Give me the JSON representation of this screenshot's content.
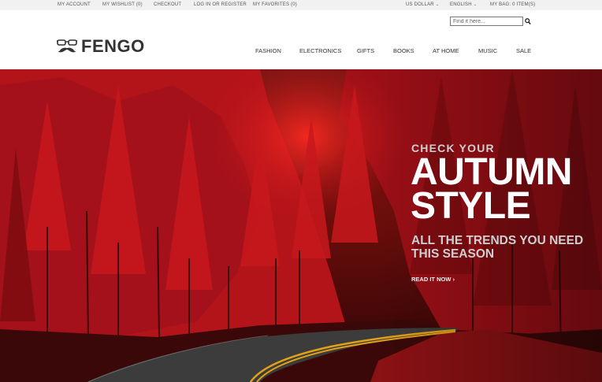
{
  "topbar": {
    "links": [
      "MY ACCOUNT",
      "MY WISHLIST (0)",
      "CHECKOUT",
      "LOG IN OR REGISTER",
      "MY FAVORITES (0)"
    ],
    "currency": "US DOLLAR",
    "language": "ENGLISH",
    "bag": "MY BAG: 0 ITEM(S)"
  },
  "search": {
    "placeholder": "Find it here..."
  },
  "logo": {
    "text": "FENGO"
  },
  "nav": [
    "FASHION",
    "ELECTRONICS",
    "GIFTS",
    "BOOKS",
    "AT HOME",
    "MUSIC",
    "SALE"
  ],
  "hero": {
    "kicker": "CHECK  YOUR",
    "headline": "AUTUMN\nSTYLE",
    "subhead": "ALL THE TRENDS YOU NEED\nTHIS SEASON",
    "cta": "READ IT NOW",
    "cta_icon": "›"
  },
  "icons": {
    "logo": "glasses-mustache-icon",
    "search": "search-icon",
    "dropdown": "chevron-down-icon"
  },
  "colors": {
    "hero_red": "#c0141c",
    "hero_dark": "#2a0505",
    "topbar_bg": "#f1f1f1",
    "text_dark": "#333333"
  }
}
